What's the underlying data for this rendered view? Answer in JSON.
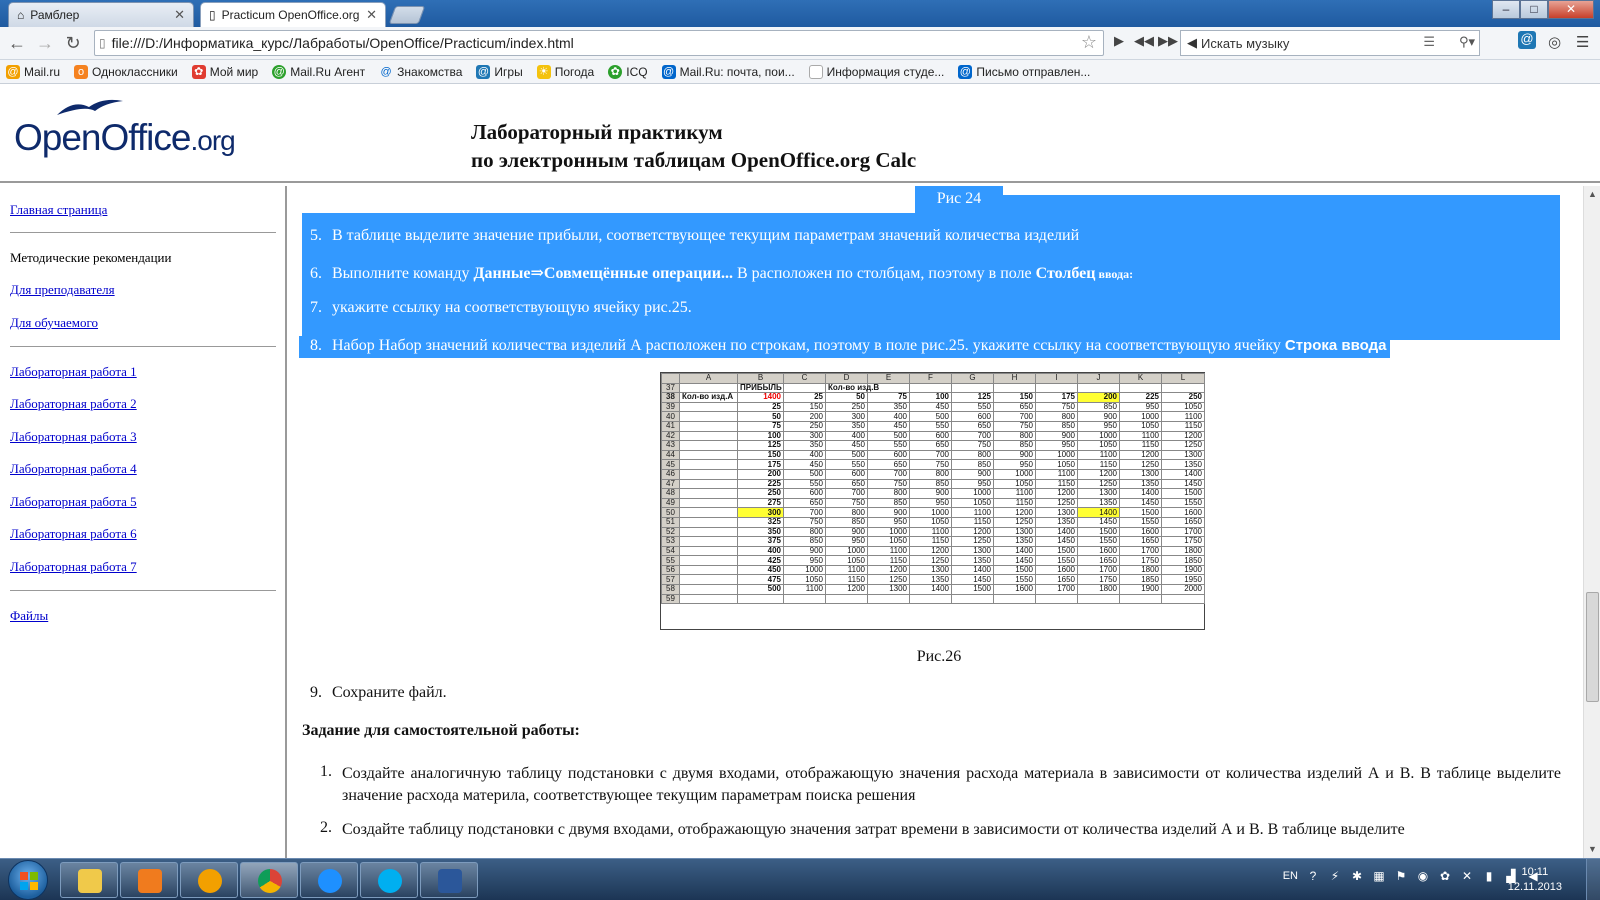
{
  "browser": {
    "tabs": [
      {
        "title": "Рамблер",
        "active": false
      },
      {
        "title": "Practicum OpenOffice.org",
        "active": true
      }
    ],
    "window_buttons": {
      "minimize": "‒",
      "maximize": "□",
      "close": "✕"
    },
    "url": "file:///D:/Информатика_курс/Лабработы/OpenOffice/Practicum/index.html",
    "music_search_placeholder": "Искать музыку",
    "bookmarks": [
      {
        "label": "Mail.ru",
        "color": "#f2a000"
      },
      {
        "label": "Одноклассники",
        "color": "#f58220"
      },
      {
        "label": "Мой мир",
        "color": "#e03c31"
      },
      {
        "label": "Mail.Ru Агент",
        "color": "#2ca02c"
      },
      {
        "label": "Знакомства",
        "color": "#0066cc"
      },
      {
        "label": "Игры",
        "color": "#1f77b4"
      },
      {
        "label": "Погода",
        "color": "#f4c20d"
      },
      {
        "label": "ICQ",
        "color": "#2ca02c"
      },
      {
        "label": "Mail.Ru: почта, пои...",
        "color": "#0066cc"
      },
      {
        "label": "Информация студе...",
        "color": "#bbbbbb"
      },
      {
        "label": "Письмо отправлен...",
        "color": "#0066cc"
      }
    ]
  },
  "header": {
    "logo_main": "OpenOffice",
    "logo_suffix": ".org",
    "title_line1": "Лабораторный практикум",
    "title_line2": "по электронным таблицам OpenOffice.org Calc"
  },
  "nav": {
    "home": "Главная страница",
    "methodics": "Методические рекомендации",
    "for_teacher": "Для преподавателя",
    "for_student": "Для обучаемого",
    "labs": [
      "Лабораторная работа 1",
      "Лабораторная работа 2",
      "Лабораторная работа 3",
      "Лабораторная работа 4",
      "Лабораторная работа 5",
      "Лабораторная работа 6",
      "Лабораторная работа 7"
    ],
    "files": "Файлы"
  },
  "content": {
    "fig24_caption": "Рис 24",
    "steps": [
      {
        "num": "5.",
        "text": "В таблице выделите значение прибыли, соответствующее текущим параметрам значений количества изделий"
      },
      {
        "num": "6.",
        "pre": "Выполните команду ",
        "cmd": "Данные⇒Совмещённые операции...",
        "mid": " В расположен по столбцам, поэтому в поле ",
        "field": "Столбец",
        "field_small": " ввода:"
      },
      {
        "num": "7.",
        "text": "укажите ссылку на соответствующую ячейку рис.25."
      },
      {
        "num": "8.",
        "text": "Набор Набор значений количества изделий А расположен по строкам, поэтому в поле рис.25. укажите ссылку на соответствующую ячейку ",
        "field": "Строка ввода"
      }
    ],
    "fig26_caption": "Рис.26",
    "step9": {
      "num": "9.",
      "text": "Сохраните файл."
    },
    "task_heading": "Задание для самостоятельной работы:",
    "tasks": [
      {
        "num": "1.",
        "text": "Создайте аналогичную таблицу подстановки с двумя входами, отображающую значения расхода материала в зависимости от количества изделий А и В. В таблице выделите значение расхода материла, соответствующее текущим параметрам поиска решения"
      },
      {
        "num": "2.",
        "text": "Создайте таблицу подстановки с двумя входами, отображающую значения затрат времени в зависимости от количества изделий А и В. В таблице выделите"
      }
    ]
  },
  "sheet": {
    "col_headers": [
      "",
      "A",
      "B",
      "C",
      "D",
      "E",
      "F",
      "G",
      "H",
      "I",
      "J",
      "K",
      "L"
    ],
    "row37": {
      "num": "37",
      "b": "ПРИБЫЛЬ",
      "d": "Кол-во изд.В"
    },
    "row38": {
      "num": "38",
      "a": "Кол-во изд.А",
      "b": "1400",
      "vals": [
        "25",
        "50",
        "75",
        "100",
        "125",
        "150",
        "175",
        "200",
        "225",
        "250"
      ]
    },
    "rows": [
      {
        "num": "39",
        "b": "25",
        "vals": [
          "150",
          "250",
          "350",
          "450",
          "550",
          "650",
          "750",
          "850",
          "950",
          "1050"
        ]
      },
      {
        "num": "40",
        "b": "50",
        "vals": [
          "200",
          "300",
          "400",
          "500",
          "600",
          "700",
          "800",
          "900",
          "1000",
          "1100"
        ]
      },
      {
        "num": "41",
        "b": "75",
        "vals": [
          "250",
          "350",
          "450",
          "550",
          "650",
          "750",
          "850",
          "950",
          "1050",
          "1150"
        ]
      },
      {
        "num": "42",
        "b": "100",
        "vals": [
          "300",
          "400",
          "500",
          "600",
          "700",
          "800",
          "900",
          "1000",
          "1100",
          "1200"
        ]
      },
      {
        "num": "43",
        "b": "125",
        "vals": [
          "350",
          "450",
          "550",
          "650",
          "750",
          "850",
          "950",
          "1050",
          "1150",
          "1250"
        ]
      },
      {
        "num": "44",
        "b": "150",
        "vals": [
          "400",
          "500",
          "600",
          "700",
          "800",
          "900",
          "1000",
          "1100",
          "1200",
          "1300"
        ]
      },
      {
        "num": "45",
        "b": "175",
        "vals": [
          "450",
          "550",
          "650",
          "750",
          "850",
          "950",
          "1050",
          "1150",
          "1250",
          "1350"
        ]
      },
      {
        "num": "46",
        "b": "200",
        "vals": [
          "500",
          "600",
          "700",
          "800",
          "900",
          "1000",
          "1100",
          "1200",
          "1300",
          "1400"
        ]
      },
      {
        "num": "47",
        "b": "225",
        "vals": [
          "550",
          "650",
          "750",
          "850",
          "950",
          "1050",
          "1150",
          "1250",
          "1350",
          "1450"
        ]
      },
      {
        "num": "48",
        "b": "250",
        "vals": [
          "600",
          "700",
          "800",
          "900",
          "1000",
          "1100",
          "1200",
          "1300",
          "1400",
          "1500"
        ]
      },
      {
        "num": "49",
        "b": "275",
        "vals": [
          "650",
          "750",
          "850",
          "950",
          "1050",
          "1150",
          "1250",
          "1350",
          "1450",
          "1550"
        ]
      },
      {
        "num": "50",
        "b": "300",
        "vals": [
          "700",
          "800",
          "900",
          "1000",
          "1100",
          "1200",
          "1300",
          "1400",
          "1500",
          "1600"
        ]
      },
      {
        "num": "51",
        "b": "325",
        "vals": [
          "750",
          "850",
          "950",
          "1050",
          "1150",
          "1250",
          "1350",
          "1450",
          "1550",
          "1650"
        ]
      },
      {
        "num": "52",
        "b": "350",
        "vals": [
          "800",
          "900",
          "1000",
          "1100",
          "1200",
          "1300",
          "1400",
          "1500",
          "1600",
          "1700"
        ]
      },
      {
        "num": "53",
        "b": "375",
        "vals": [
          "850",
          "950",
          "1050",
          "1150",
          "1250",
          "1350",
          "1450",
          "1550",
          "1650",
          "1750"
        ]
      },
      {
        "num": "54",
        "b": "400",
        "vals": [
          "900",
          "1000",
          "1100",
          "1200",
          "1300",
          "1400",
          "1500",
          "1600",
          "1700",
          "1800"
        ]
      },
      {
        "num": "55",
        "b": "425",
        "vals": [
          "950",
          "1050",
          "1150",
          "1250",
          "1350",
          "1450",
          "1550",
          "1650",
          "1750",
          "1850"
        ]
      },
      {
        "num": "56",
        "b": "450",
        "vals": [
          "1000",
          "1100",
          "1200",
          "1300",
          "1400",
          "1500",
          "1600",
          "1700",
          "1800",
          "1900"
        ]
      },
      {
        "num": "57",
        "b": "475",
        "vals": [
          "1050",
          "1150",
          "1250",
          "1350",
          "1450",
          "1550",
          "1650",
          "1750",
          "1850",
          "1950"
        ]
      },
      {
        "num": "58",
        "b": "500",
        "vals": [
          "1100",
          "1200",
          "1300",
          "1400",
          "1500",
          "1600",
          "1700",
          "1800",
          "1900",
          "2000"
        ]
      }
    ],
    "row59": {
      "num": "59"
    },
    "highlight_color": "#ffff33"
  },
  "taskbar": {
    "lang": "EN",
    "time": "10:11",
    "date": "12.11.2013",
    "apps": [
      "explorer",
      "media-player",
      "mail-agent",
      "chrome",
      "internet-explorer",
      "skype",
      "word"
    ]
  },
  "colors": {
    "selection": "#3399ff",
    "link": "#0000cc",
    "logo": "#0e2a6b"
  }
}
